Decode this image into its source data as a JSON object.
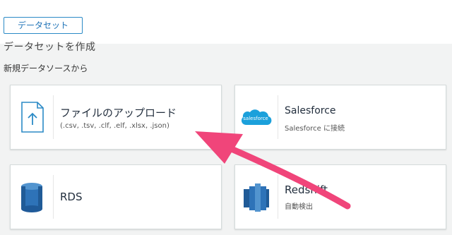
{
  "toolbar": {
    "dataset_button": "データセット"
  },
  "page": {
    "heading": "データセットを作成",
    "subheading": "新規データソースから"
  },
  "sources": {
    "upload": {
      "title": "ファイルのアップロード",
      "sub": "(.csv, .tsv, .clf, .elf, .xlsx, .json)",
      "icon": "file-upload-icon"
    },
    "salesforce": {
      "title": "Salesforce",
      "sub": "Salesforce に接続",
      "icon": "salesforce-logo-icon",
      "icon_text": "salesforce"
    },
    "rds": {
      "title": "RDS",
      "icon": "rds-database-icon"
    },
    "redshift": {
      "title": "Redshift",
      "sub": "自動検出",
      "icon": "redshift-icon"
    }
  },
  "colors": {
    "accent": "#1f73b7",
    "arrow": "#f0457a",
    "salesforce": "#1ba0db",
    "aws_blue": "#2e73b8"
  }
}
